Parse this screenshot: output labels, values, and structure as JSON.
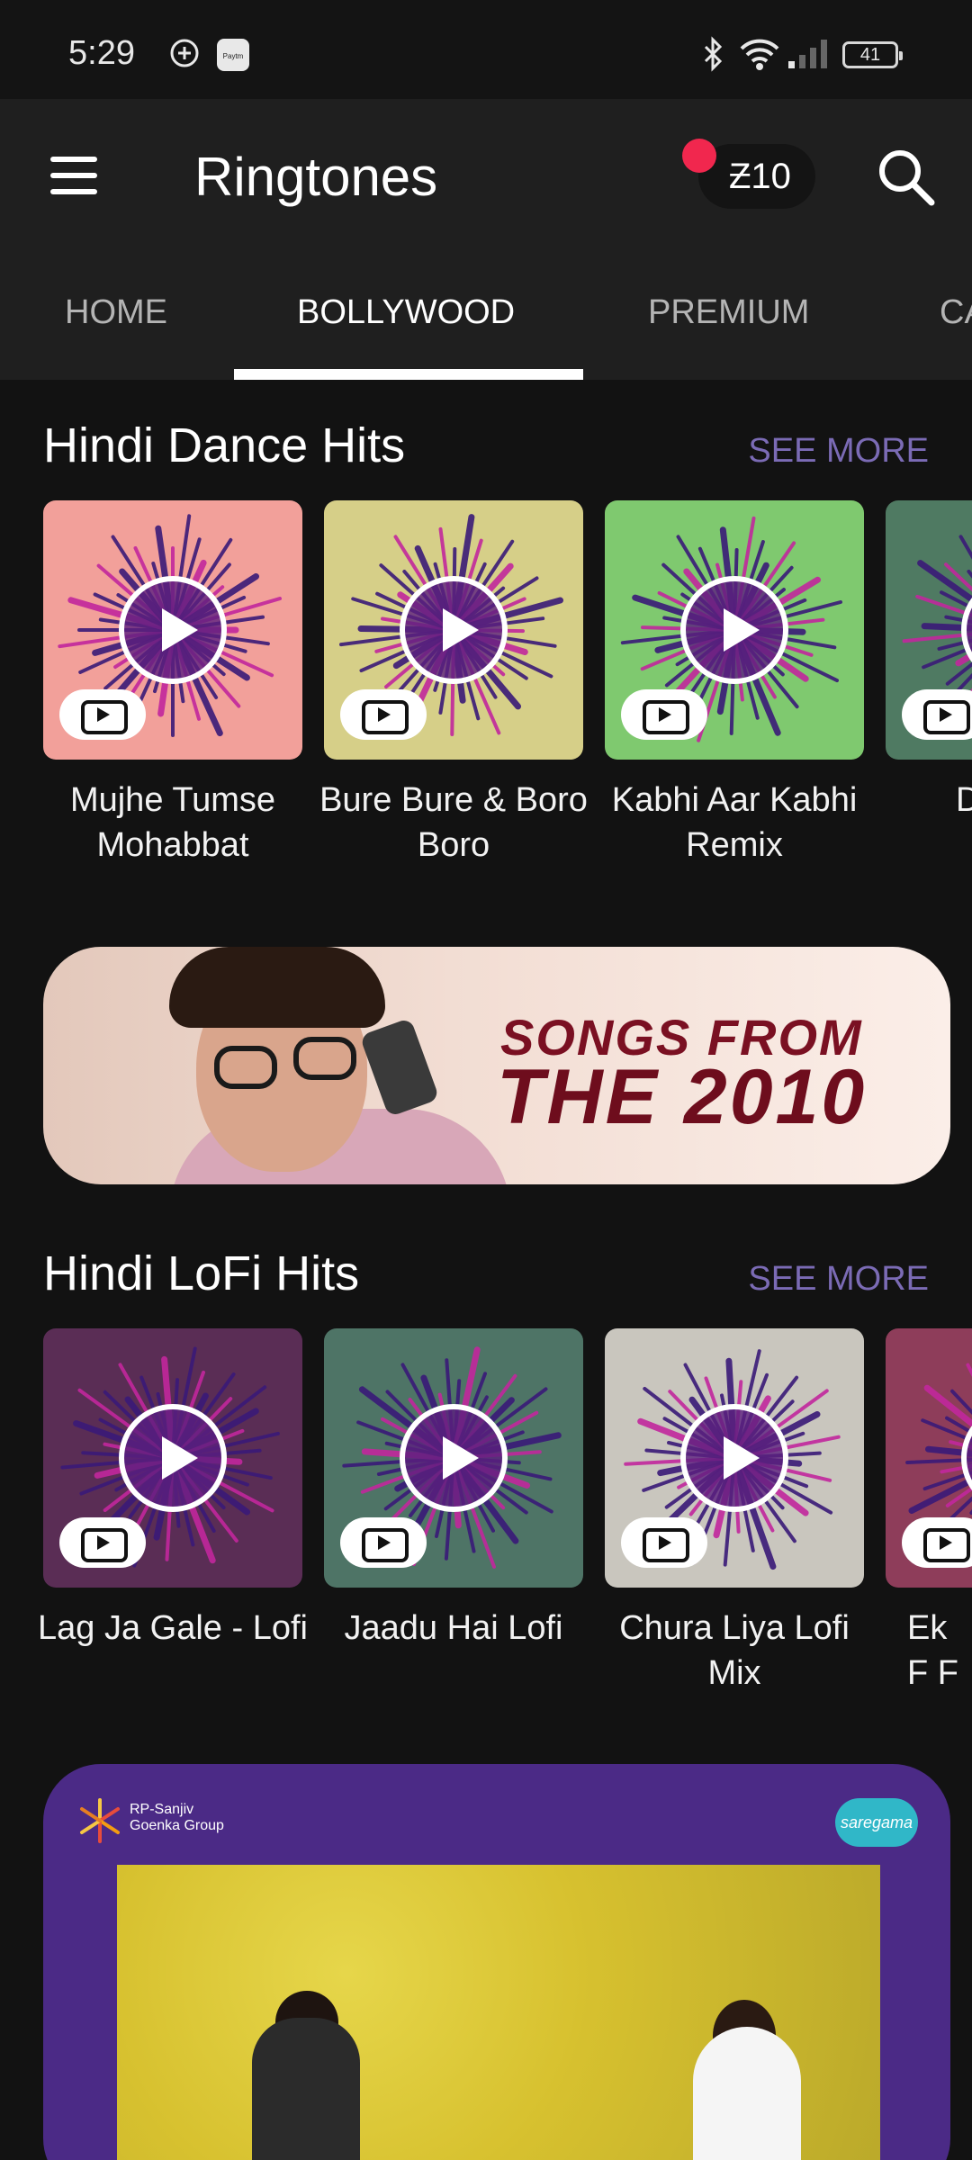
{
  "status_bar": {
    "time": "5:29",
    "battery": "41",
    "icons": [
      "shield-plus-icon",
      "paytm-icon",
      "bluetooth-icon",
      "wifi-icon",
      "signal-icon"
    ]
  },
  "app_bar": {
    "title": "Ringtones",
    "coins": "Ƶ10",
    "notification_dot_color": "#f1274e"
  },
  "tabs": [
    {
      "label": "HOME",
      "active": false
    },
    {
      "label": "BOLLYWOOD",
      "active": true
    },
    {
      "label": "PREMIUM",
      "active": false
    },
    {
      "label": "CA",
      "active": false
    }
  ],
  "sections": [
    {
      "title": "Hindi Dance Hits",
      "see_more": "SEE MORE",
      "items": [
        {
          "label": "Mujhe Tumse Mohabbat",
          "bg": "#f2a09a"
        },
        {
          "label": "Bure Bure & Boro Boro",
          "bg": "#d6cf88"
        },
        {
          "label": "Kabhi Aar Kabhi Remix",
          "bg": "#7fc96f"
        },
        {
          "label": "D",
          "bg": "#4f7a62"
        }
      ]
    },
    {
      "title": "Hindi LoFi Hits",
      "see_more": "SEE MORE",
      "items": [
        {
          "label": "Lag Ja Gale - Lofi",
          "bg": "#5a2d55"
        },
        {
          "label": "Jaadu Hai Lofi",
          "bg": "#4e7466"
        },
        {
          "label": "Chura Liya Lofi Mix",
          "bg": "#c9c6be"
        },
        {
          "label": "Ek F F",
          "bg": "#8e3d5a"
        }
      ]
    }
  ],
  "banners": {
    "songs_2010": {
      "line1": "SONGS FROM",
      "line2": "THE 2010"
    },
    "ddlj": {
      "brand": "RP-Sanjiv Goenka Group",
      "label": "saregama"
    }
  }
}
